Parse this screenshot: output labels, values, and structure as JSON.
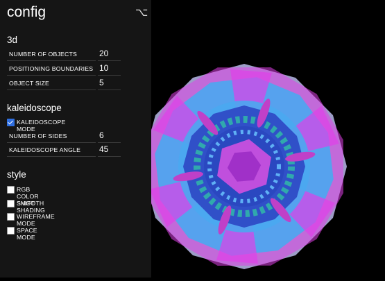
{
  "panel": {
    "title": "config",
    "toggle_icon": "option-key-icon",
    "toggle_glyph": "⌥",
    "sections": {
      "three_d": {
        "title": "3d",
        "number_of_objects": {
          "label": "NUMBER OF OBJECTS",
          "value": "20"
        },
        "positioning_boundaries": {
          "label": "POSITIONING BOUNDARIES",
          "value": "10"
        },
        "object_size": {
          "label": "OBJECT SIZE",
          "value": "5"
        }
      },
      "kaleidoscope": {
        "title": "kaleidoscope",
        "mode": {
          "label": "KALEIDOSCOPE MODE",
          "checked": true
        },
        "number_of_sides": {
          "label": "NUMBER OF SIDES",
          "value": "6"
        },
        "angle": {
          "label": "KALEIDOSCOPE ANGLE",
          "value": "45"
        }
      },
      "style": {
        "title": "style",
        "rgb_color_shift": {
          "label": "RGB COLOR SHIFT",
          "checked": false
        },
        "smooth_shading": {
          "label": "SMOOTH SHADING",
          "checked": false
        },
        "wireframe_mode": {
          "label": "WIREFRAME MODE",
          "checked": false
        },
        "space_mode": {
          "label": "SPACE MODE",
          "checked": false
        }
      }
    }
  },
  "colors": {
    "panel_bg": "#151515",
    "canvas_bg": "#000000",
    "magenta": "#e040e8",
    "sky_blue": "#4aa8f0",
    "deep_blue": "#3050c8",
    "lavender": "#b8b8ea",
    "teal": "#30b8a8",
    "checkbox_accent": "#2f6fe0"
  }
}
